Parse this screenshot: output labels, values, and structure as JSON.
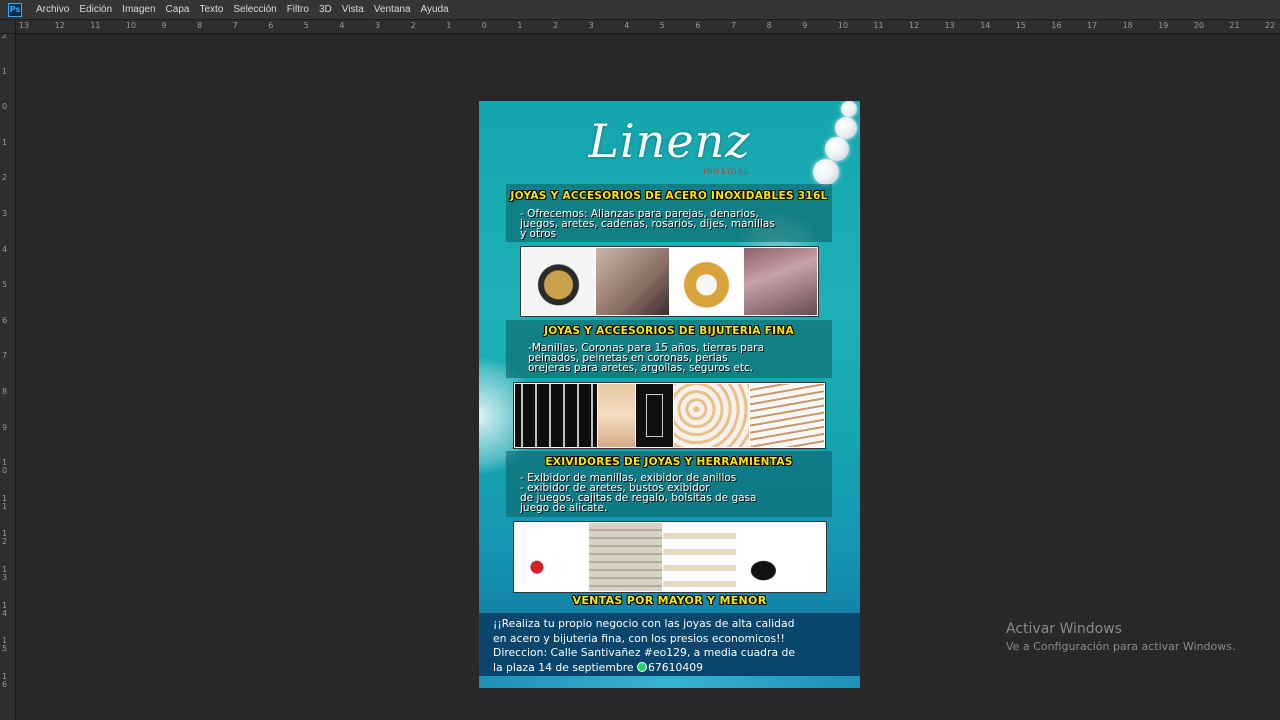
{
  "app": {
    "logo_text": "Ps",
    "menu": [
      "Archivo",
      "Edición",
      "Imagen",
      "Capa",
      "Texto",
      "Selección",
      "Filtro",
      "3D",
      "Vista",
      "Ventana",
      "Ayuda"
    ]
  },
  "ruler": {
    "top_labels": [
      "13",
      "12",
      "11",
      "10",
      "9",
      "8",
      "7",
      "6",
      "5",
      "4",
      "3",
      "2",
      "1",
      "0",
      "1",
      "2",
      "3",
      "4",
      "5",
      "6",
      "7",
      "8",
      "9",
      "10",
      "11",
      "12",
      "13",
      "14",
      "15",
      "16",
      "17",
      "18",
      "19",
      "20",
      "21",
      "22"
    ],
    "left_labels": [
      "2",
      "1",
      "0",
      "1",
      "2",
      "3",
      "4",
      "5",
      "6",
      "7",
      "8",
      "9",
      "10",
      "11",
      "12",
      "13",
      "14",
      "15",
      "16"
    ]
  },
  "flyer": {
    "logo_main": "Linenz",
    "logo_sub": "INOXIDAL",
    "section1": {
      "title": "JOYAS Y ACCESORIOS DE ACERO INOXIDABLES 316L",
      "body": "- Ofrecemos: Alianzas para parejas, denarios,\njuegos, aretes, cadenas, rosarios, dijes, manillas\ny otros"
    },
    "section2": {
      "title": "JOYAS Y ACCESORIOS DE BIJUTERIA FINA",
      "body": "-Manillas, Coronas para 15 años, tierras para\npeinados, peinetas en coronas, perlas\norejeras para aretes, argollas, seguros etc."
    },
    "section3": {
      "title": "EXIVIDORES DE JOYAS Y HERRAMIENTAS",
      "body": "- Exibidor de manillas, exibidor de anillos\n- exibidor de aretes, bustos exibidor\nde juegos, cajitas de regalo, bolsitas de gasa\njuego de alicate."
    },
    "ventas": "VENTAS POR MAYOR Y MENOR",
    "footer_line1": "¡¡Realiza tu propio negocio con las joyas de alta calidad",
    "footer_line2": "en acero y bijuteria fina, con los presios economicos!!",
    "footer_line3": "Direccion: Calle Santivañez #eo129, a media cuadra de",
    "footer_line4_a": "la plaza 14 de septiembre",
    "footer_phone": "67610409"
  },
  "watermark": {
    "title": "Activar Windows",
    "subtitle": "Ve a Configuración para activar Windows."
  },
  "colors": {
    "accent_yellow": "#ffe600",
    "ps_blue": "#31a8ff",
    "teal": "#16a8b0"
  }
}
